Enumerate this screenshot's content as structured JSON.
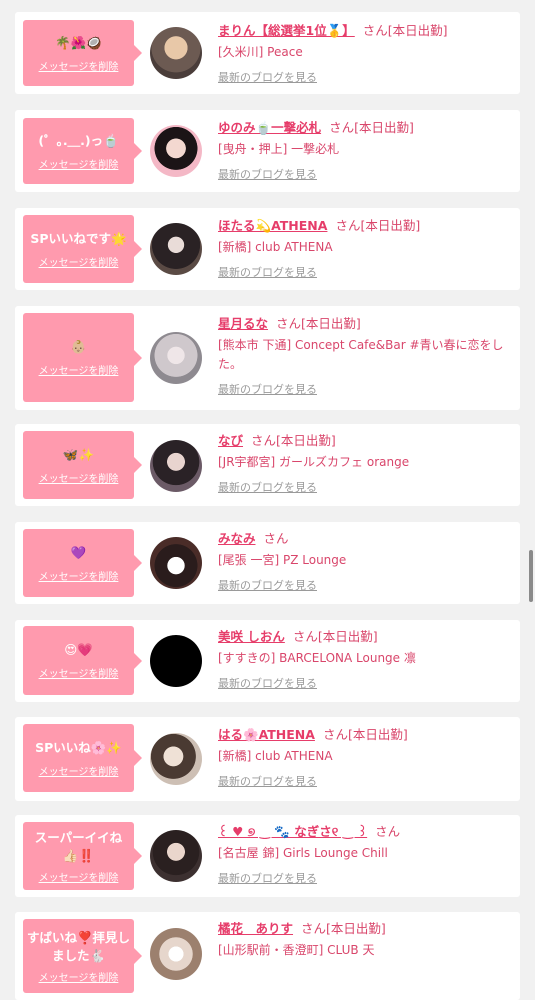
{
  "common": {
    "delete_label": "メッセージを削除",
    "blog_label": "最新のブログを見る",
    "accent_color": "#ff9aae",
    "name_color": "#e63d6a"
  },
  "cards": [
    {
      "message": "🌴🌺🥥",
      "name": "まりん【総選挙1位🥇】",
      "san": "さん[本日出勤]",
      "shop": "[久米川] Peace"
    },
    {
      "message": "(゜｡.＿.)っ🍵",
      "name": "ゆのみ🍵一撃必札",
      "san": "さん[本日出勤]",
      "shop": "[曳舟・押上] 一撃必札"
    },
    {
      "message": "SPいいねです🌟",
      "name": "ほたる💫ATHENA",
      "san": "さん[本日出勤]",
      "shop": "[新橋] club ATHENA"
    },
    {
      "message": "👶🏼",
      "name": "星月るな",
      "san": "さん[本日出勤]",
      "shop": "[熊本市 下通] Concept Cafe&Bar #青い春に恋をした。"
    },
    {
      "message": "🦋✨",
      "name": "なび",
      "san": "さん[本日出勤]",
      "shop": "[JR宇都宮] ガールズカフェ orange"
    },
    {
      "message": "💜",
      "name": "みなみ",
      "san": "さん",
      "shop": "[尾張 一宮] PZ Lounge"
    },
    {
      "message": "😍💗",
      "name": "美咲 しおん",
      "san": "さん[本日出勤]",
      "shop": "[すすきの] BARCELONA Lounge 凛"
    },
    {
      "message": "SPいいね🌸✨",
      "name": "はる🌸ATHENA",
      "san": "さん[本日出勤]",
      "shop": "[新橋] club ATHENA"
    },
    {
      "message": "スーパーイイね\n👍🏻‼️",
      "name": "꒰ ♥ ୭ ‿ 🐾 なぎさ୧ ‿ ꒱",
      "san": "さん",
      "shop": "[名古屋 錦] Girls Lounge Chill"
    },
    {
      "message": "すばいね❣️拝見し\nました🐇",
      "name": "橘花　ありす",
      "san": "さん[本日出勤]",
      "shop": "[山形駅前・香澄町] CLUB 天"
    }
  ]
}
